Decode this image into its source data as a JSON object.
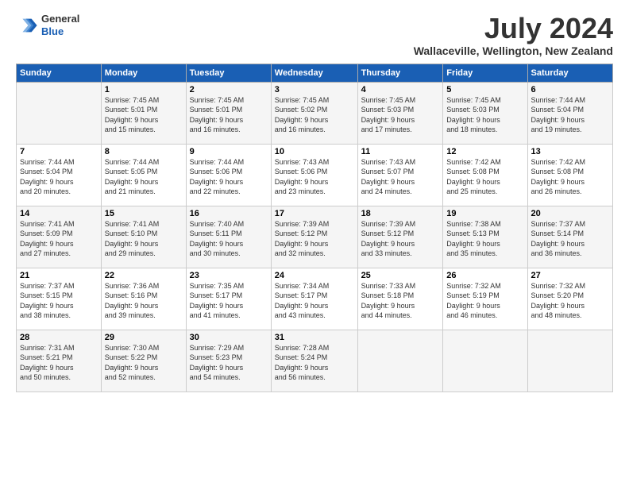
{
  "header": {
    "logo_line1": "General",
    "logo_line2": "Blue",
    "month_year": "July 2024",
    "location": "Wallaceville, Wellington, New Zealand"
  },
  "days_of_week": [
    "Sunday",
    "Monday",
    "Tuesday",
    "Wednesday",
    "Thursday",
    "Friday",
    "Saturday"
  ],
  "weeks": [
    [
      {
        "day": "",
        "info": ""
      },
      {
        "day": "1",
        "info": "Sunrise: 7:45 AM\nSunset: 5:01 PM\nDaylight: 9 hours\nand 15 minutes."
      },
      {
        "day": "2",
        "info": "Sunrise: 7:45 AM\nSunset: 5:01 PM\nDaylight: 9 hours\nand 16 minutes."
      },
      {
        "day": "3",
        "info": "Sunrise: 7:45 AM\nSunset: 5:02 PM\nDaylight: 9 hours\nand 16 minutes."
      },
      {
        "day": "4",
        "info": "Sunrise: 7:45 AM\nSunset: 5:03 PM\nDaylight: 9 hours\nand 17 minutes."
      },
      {
        "day": "5",
        "info": "Sunrise: 7:45 AM\nSunset: 5:03 PM\nDaylight: 9 hours\nand 18 minutes."
      },
      {
        "day": "6",
        "info": "Sunrise: 7:44 AM\nSunset: 5:04 PM\nDaylight: 9 hours\nand 19 minutes."
      }
    ],
    [
      {
        "day": "7",
        "info": "Sunrise: 7:44 AM\nSunset: 5:04 PM\nDaylight: 9 hours\nand 20 minutes."
      },
      {
        "day": "8",
        "info": "Sunrise: 7:44 AM\nSunset: 5:05 PM\nDaylight: 9 hours\nand 21 minutes."
      },
      {
        "day": "9",
        "info": "Sunrise: 7:44 AM\nSunset: 5:06 PM\nDaylight: 9 hours\nand 22 minutes."
      },
      {
        "day": "10",
        "info": "Sunrise: 7:43 AM\nSunset: 5:06 PM\nDaylight: 9 hours\nand 23 minutes."
      },
      {
        "day": "11",
        "info": "Sunrise: 7:43 AM\nSunset: 5:07 PM\nDaylight: 9 hours\nand 24 minutes."
      },
      {
        "day": "12",
        "info": "Sunrise: 7:42 AM\nSunset: 5:08 PM\nDaylight: 9 hours\nand 25 minutes."
      },
      {
        "day": "13",
        "info": "Sunrise: 7:42 AM\nSunset: 5:08 PM\nDaylight: 9 hours\nand 26 minutes."
      }
    ],
    [
      {
        "day": "14",
        "info": "Sunrise: 7:41 AM\nSunset: 5:09 PM\nDaylight: 9 hours\nand 27 minutes."
      },
      {
        "day": "15",
        "info": "Sunrise: 7:41 AM\nSunset: 5:10 PM\nDaylight: 9 hours\nand 29 minutes."
      },
      {
        "day": "16",
        "info": "Sunrise: 7:40 AM\nSunset: 5:11 PM\nDaylight: 9 hours\nand 30 minutes."
      },
      {
        "day": "17",
        "info": "Sunrise: 7:39 AM\nSunset: 5:12 PM\nDaylight: 9 hours\nand 32 minutes."
      },
      {
        "day": "18",
        "info": "Sunrise: 7:39 AM\nSunset: 5:12 PM\nDaylight: 9 hours\nand 33 minutes."
      },
      {
        "day": "19",
        "info": "Sunrise: 7:38 AM\nSunset: 5:13 PM\nDaylight: 9 hours\nand 35 minutes."
      },
      {
        "day": "20",
        "info": "Sunrise: 7:37 AM\nSunset: 5:14 PM\nDaylight: 9 hours\nand 36 minutes."
      }
    ],
    [
      {
        "day": "21",
        "info": "Sunrise: 7:37 AM\nSunset: 5:15 PM\nDaylight: 9 hours\nand 38 minutes."
      },
      {
        "day": "22",
        "info": "Sunrise: 7:36 AM\nSunset: 5:16 PM\nDaylight: 9 hours\nand 39 minutes."
      },
      {
        "day": "23",
        "info": "Sunrise: 7:35 AM\nSunset: 5:17 PM\nDaylight: 9 hours\nand 41 minutes."
      },
      {
        "day": "24",
        "info": "Sunrise: 7:34 AM\nSunset: 5:17 PM\nDaylight: 9 hours\nand 43 minutes."
      },
      {
        "day": "25",
        "info": "Sunrise: 7:33 AM\nSunset: 5:18 PM\nDaylight: 9 hours\nand 44 minutes."
      },
      {
        "day": "26",
        "info": "Sunrise: 7:32 AM\nSunset: 5:19 PM\nDaylight: 9 hours\nand 46 minutes."
      },
      {
        "day": "27",
        "info": "Sunrise: 7:32 AM\nSunset: 5:20 PM\nDaylight: 9 hours\nand 48 minutes."
      }
    ],
    [
      {
        "day": "28",
        "info": "Sunrise: 7:31 AM\nSunset: 5:21 PM\nDaylight: 9 hours\nand 50 minutes."
      },
      {
        "day": "29",
        "info": "Sunrise: 7:30 AM\nSunset: 5:22 PM\nDaylight: 9 hours\nand 52 minutes."
      },
      {
        "day": "30",
        "info": "Sunrise: 7:29 AM\nSunset: 5:23 PM\nDaylight: 9 hours\nand 54 minutes."
      },
      {
        "day": "31",
        "info": "Sunrise: 7:28 AM\nSunset: 5:24 PM\nDaylight: 9 hours\nand 56 minutes."
      },
      {
        "day": "",
        "info": ""
      },
      {
        "day": "",
        "info": ""
      },
      {
        "day": "",
        "info": ""
      }
    ]
  ]
}
